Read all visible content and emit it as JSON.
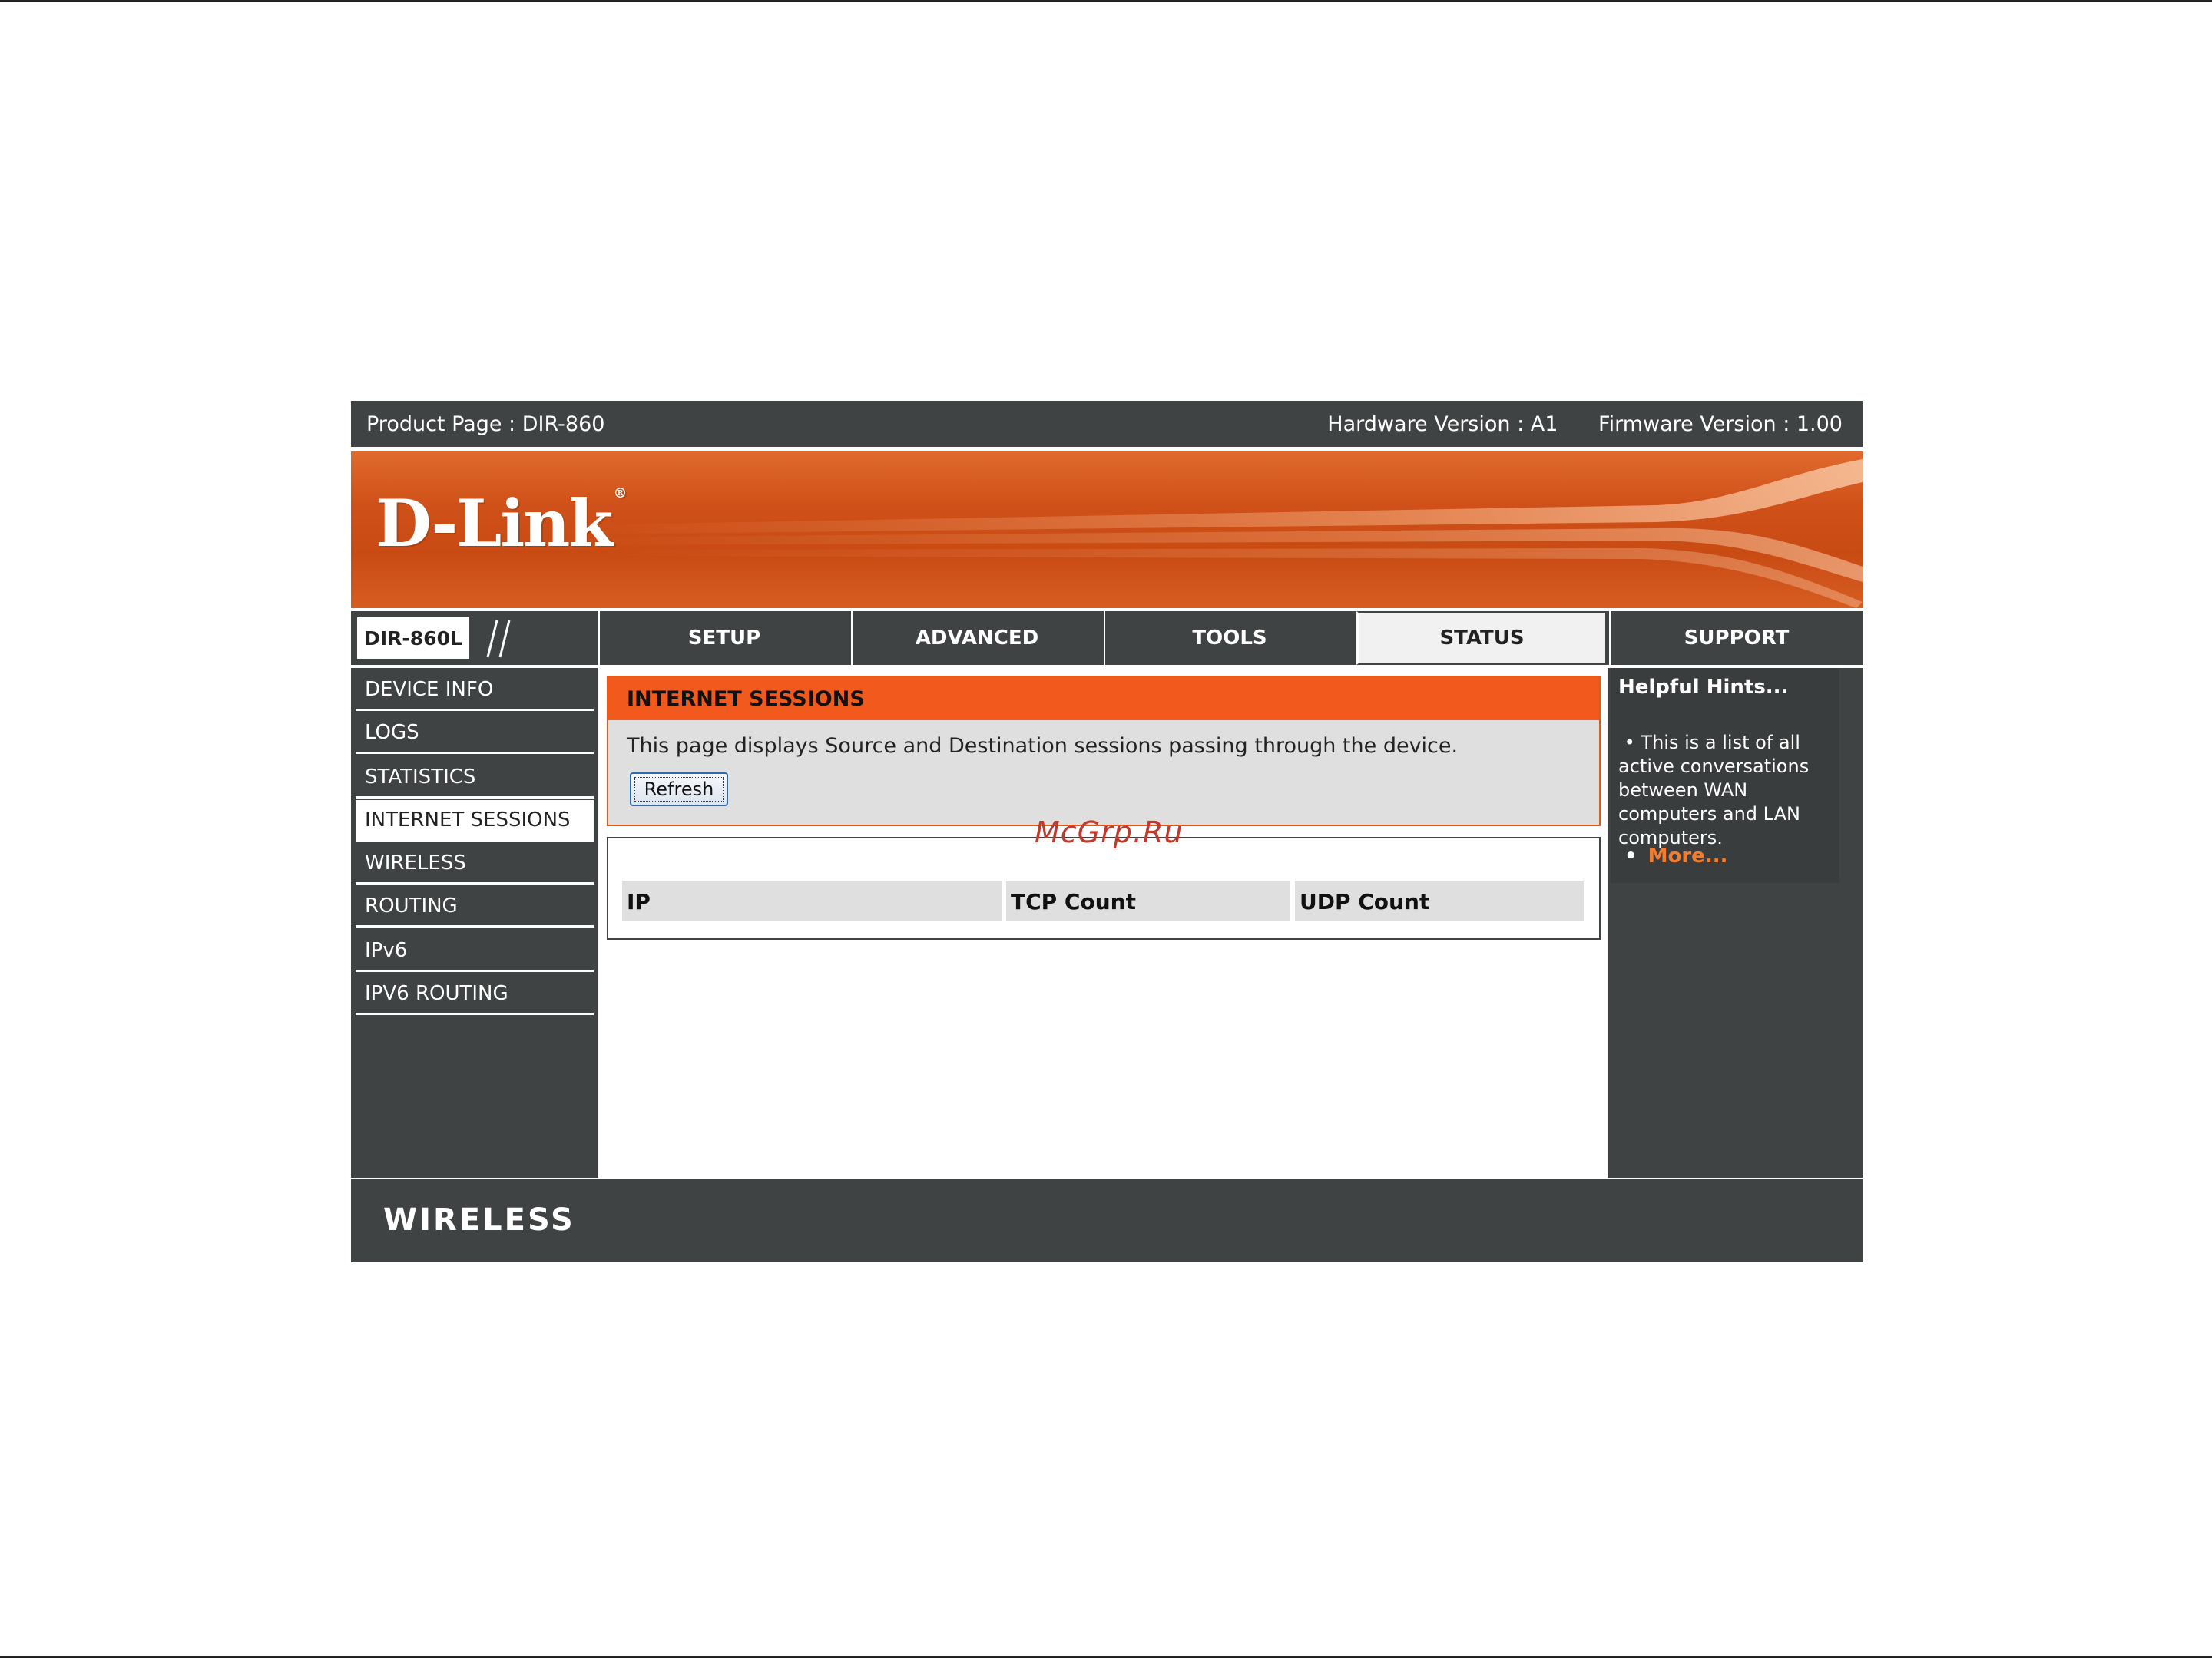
{
  "header": {
    "product_page": "Product Page : DIR-860",
    "hardware_version": "Hardware Version : A1",
    "firmware_version": "Firmware Version : 1.00"
  },
  "brand": {
    "logo": "D-Link",
    "registered": "®",
    "model": "DIR-860L",
    "accent_color": "#f15a1c"
  },
  "tabs": [
    {
      "label": "SETUP",
      "active": false
    },
    {
      "label": "ADVANCED",
      "active": false
    },
    {
      "label": "TOOLS",
      "active": false
    },
    {
      "label": "STATUS",
      "active": true
    },
    {
      "label": "SUPPORT",
      "active": false
    }
  ],
  "sidebar": {
    "items": [
      {
        "label": "DEVICE INFO",
        "active": false
      },
      {
        "label": "LOGS",
        "active": false
      },
      {
        "label": "STATISTICS",
        "active": false
      },
      {
        "label": "INTERNET SESSIONS",
        "active": true
      },
      {
        "label": "WIRELESS",
        "active": false
      },
      {
        "label": "ROUTING",
        "active": false
      },
      {
        "label": "IPv6",
        "active": false
      },
      {
        "label": "IPV6 ROUTING",
        "active": false
      }
    ]
  },
  "main": {
    "section_title": "INTERNET SESSIONS",
    "description": "This page displays Source and Destination sessions passing through the device.",
    "refresh_label": "Refresh",
    "table_headers": [
      "IP",
      "TCP Count",
      "UDP Count"
    ]
  },
  "hints": {
    "title": "Helpful Hints...",
    "text": "This is a list of all active conversations between WAN computers and LAN computers.",
    "more": "More..."
  },
  "footer": {
    "text": "WIRELESS"
  },
  "watermark": "McGrp.Ru"
}
